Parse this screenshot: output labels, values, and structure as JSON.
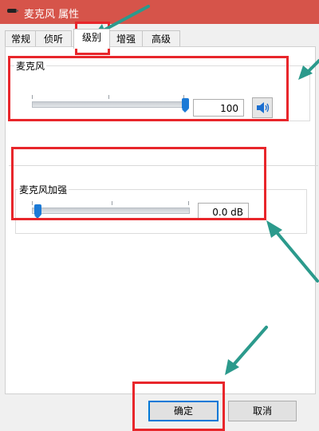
{
  "window": {
    "title": "麦克风 属性",
    "titlebar_color": "#d6544a",
    "icon": "microphone-icon"
  },
  "tabs": [
    {
      "label": "常规",
      "active": false
    },
    {
      "label": "侦听",
      "active": false
    },
    {
      "label": "级别",
      "active": true
    },
    {
      "label": "增强",
      "active": false
    },
    {
      "label": "高级",
      "active": false
    }
  ],
  "microphone": {
    "label": "麦克风",
    "value": "100",
    "level": 100,
    "speaker_icon": "speaker-icon"
  },
  "boost": {
    "label": "麦克风加强",
    "value": "0.0 dB",
    "level": 0
  },
  "buttons": {
    "ok": "确定",
    "cancel": "取消"
  },
  "annotation_colors": {
    "highlight_box": "#e8262b",
    "arrow": "#2b9a8c"
  }
}
